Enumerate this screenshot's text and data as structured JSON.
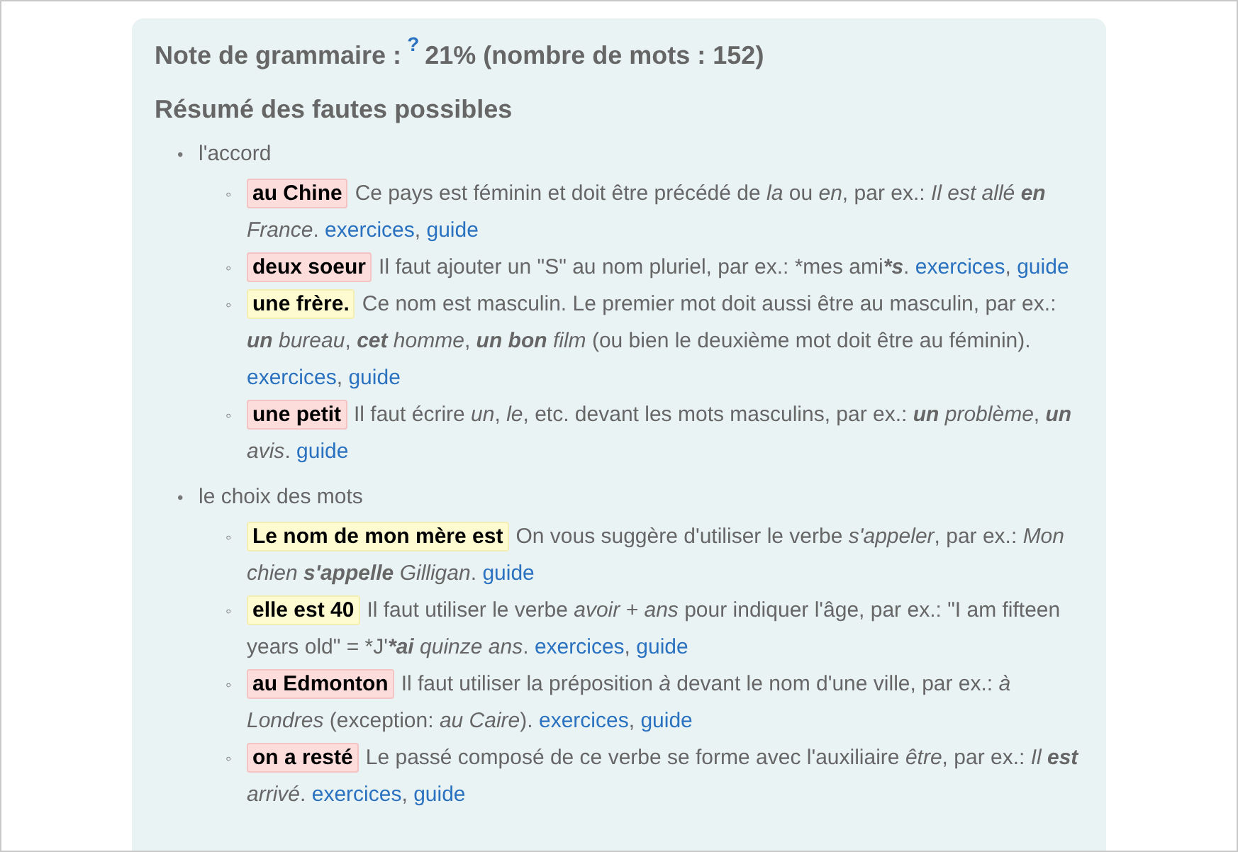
{
  "score": {
    "label": "Note de grammaire :",
    "help": "?",
    "value": "21% (nombre de mots : 152)"
  },
  "heading": "Résumé des fautes possibles",
  "categories": [
    {
      "bullet": "•",
      "name": "l'accord",
      "items": [
        {
          "bullet": "◦",
          "phrase": "au Chine",
          "color": "#fddcdc",
          "explanation": "Ce pays est féminin et doit être précédé de *la* ou *en*, par ex.: *Il est allé* **en** *France*.",
          "links": [
            "exercices",
            "guide"
          ],
          "separator": ","
        },
        {
          "bullet": "◦",
          "phrase": "deux soeur",
          "color": "#fddcdc",
          "explanation": "Il faut ajouter un \"S\" au nom pluriel, par ex.: *mes ami***s**.",
          "links": [
            "exercices",
            "guide"
          ],
          "separator": ","
        },
        {
          "bullet": "◦",
          "phrase": "une frère.",
          "color": "#fdfbcf",
          "explanation": "Ce nom est masculin. Le premier mot doit aussi être au masculin, par ex.: **un** *bureau*, **cet** *homme*, **un bon** *film* (ou bien le deuxième mot doit être au féminin).",
          "links": [
            "exercices",
            "guide"
          ],
          "separator": ","
        },
        {
          "bullet": "◦",
          "phrase": "une petit",
          "color": "#fddcdc",
          "explanation": "Il faut écrire *un*, *le*, etc. devant les mots masculins, par ex.: **un** *problème*, **un** *avis*.",
          "links": [
            "guide"
          ]
        }
      ]
    },
    {
      "bullet": "•",
      "name": "le choix des mots",
      "items": [
        {
          "bullet": "◦",
          "phrase": "Le nom de mon mère est",
          "color": "#fdfbcf",
          "explanation": "On vous suggère d'utiliser le verbe *s'appeler*, par ex.: *Mon chien* **s'appelle** *Gilligan*.",
          "links": [
            "guide"
          ]
        },
        {
          "bullet": "◦",
          "phrase": "elle est 40",
          "color": "#fdfbcf",
          "explanation": "Il faut utiliser le verbe *avoir + ans* pour indiquer l'âge, par ex.: \"I am fifteen years old\" = *J'***ai** *quinze ans*.",
          "links": [
            "exercices",
            "guide"
          ],
          "separator": ","
        },
        {
          "bullet": "◦",
          "phrase": "au Edmonton",
          "color": "#fddcdc",
          "explanation": "Il faut utiliser la préposition *à* devant le nom d'une ville, par ex.: *à Londres* (exception: *au Caire*).",
          "links": [
            "exercices",
            "guide"
          ],
          "separator": ","
        },
        {
          "bullet": "◦",
          "phrase": "on a resté",
          "color": "#fddcdc",
          "explanation": "Le passé composé de ce verbe se forme avec l'auxiliaire *être*, par ex.: *Il* **est** *arrivé*.",
          "links": [
            "exercices",
            "guide"
          ],
          "separator": ","
        }
      ]
    }
  ]
}
